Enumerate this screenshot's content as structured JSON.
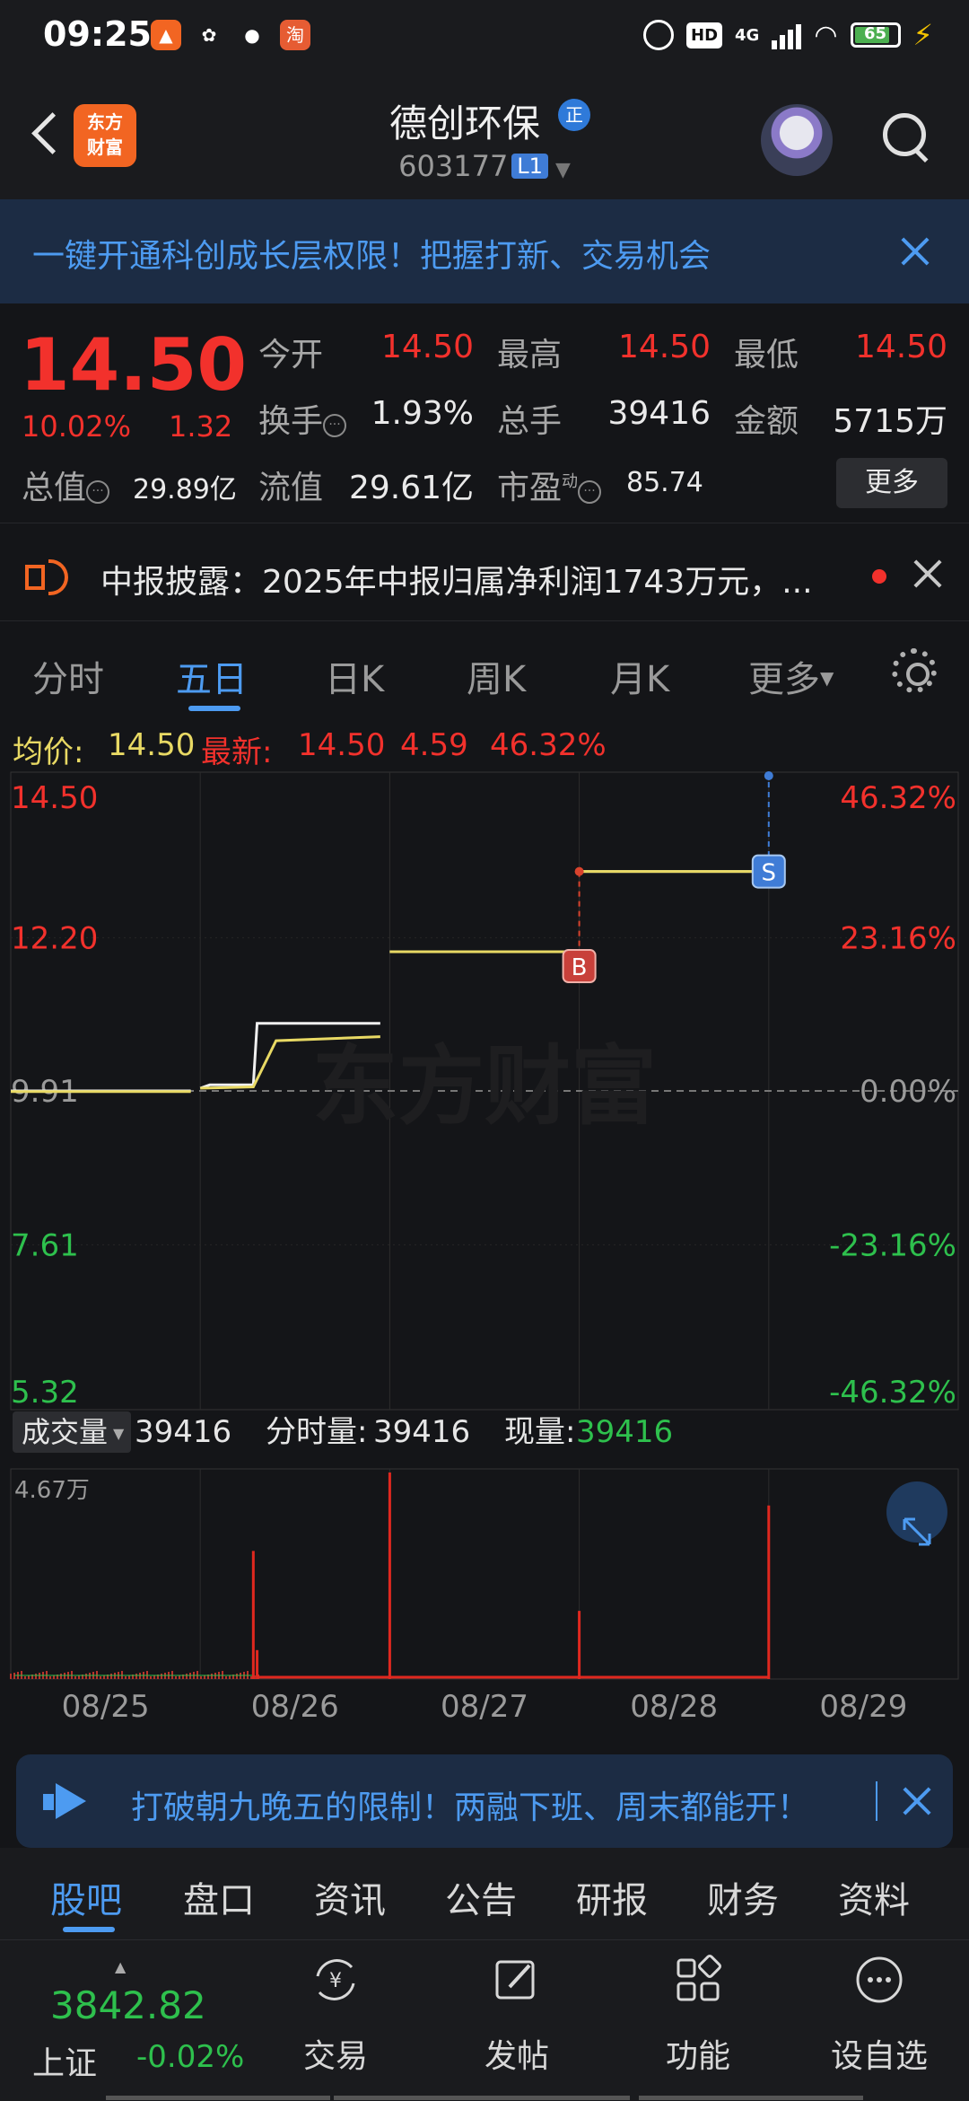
{
  "status": {
    "time": "09:25",
    "net": "4G",
    "battery": "65"
  },
  "header": {
    "logo_line1": "东方",
    "logo_line2": "财富",
    "stock_name": "德创环保",
    "verify": "正",
    "code": "603177",
    "level": "L1"
  },
  "promo": {
    "text": "一键开通科创成长层权限！把握打新、交易机会"
  },
  "quote": {
    "price": "14.50",
    "pct": "10.02%",
    "change": "1.32",
    "open_label": "今开",
    "open": "14.50",
    "high_label": "最高",
    "high": "14.50",
    "low_label": "最低",
    "low": "14.50",
    "turnover_label": "换手",
    "turnover": "1.93%",
    "volume_label": "总手",
    "volume": "39416",
    "amount_label": "金额",
    "amount": "5715万",
    "mktcap_label": "总值",
    "mktcap": "29.89亿",
    "float_label": "流值",
    "float": "29.61亿",
    "pe_label": "市盈",
    "pe_sup": "动",
    "pe": "85.74",
    "more": "更多"
  },
  "notice": {
    "text": "中报披露：2025年中报归属净利润1743万元，..."
  },
  "tabs": [
    "分时",
    "五日",
    "日K",
    "周K",
    "月K",
    "更多"
  ],
  "active_tab": 1,
  "legend": {
    "avg_label": "均价:",
    "avg": "14.50",
    "latest_label": "最新:",
    "latest": "14.50",
    "chg": "4.59",
    "pct": "46.32%"
  },
  "chart_data": {
    "type": "line",
    "title": "",
    "y_ticks_left": [
      "14.50",
      "12.20",
      "9.91",
      "7.61",
      "5.32"
    ],
    "y_ticks_right": [
      "46.32%",
      "23.16%",
      "0.00%",
      "-23.16%",
      "-46.32%"
    ],
    "x_ticks": [
      "08/25",
      "08/26",
      "08/27",
      "08/28",
      "08/29"
    ],
    "ylim": [
      5.32,
      14.5
    ],
    "base_price": 9.91,
    "series": [
      {
        "x": [
          0,
          0.95,
          1.0,
          1.05,
          1.28,
          1.3,
          1.95,
          2.0,
          2.95,
          3.0,
          3.95,
          4.0
        ],
        "y": [
          9.91,
          9.91,
          9.95,
          10.0,
          10.0,
          10.92,
          10.92,
          11.99,
          11.99,
          13.19,
          13.19,
          14.5
        ]
      },
      {
        "x": [
          0,
          0.95,
          1.0,
          1.28,
          1.4,
          1.95,
          2.0,
          2.95,
          3.0,
          3.95,
          4.0
        ],
        "y": [
          9.9,
          9.9,
          9.95,
          9.97,
          10.66,
          10.72,
          11.99,
          11.99,
          13.19,
          13.19,
          14.5
        ]
      }
    ],
    "markers": [
      {
        "label": "B"
      },
      {
        "label": "S"
      }
    ],
    "watermark": "东方财富",
    "volume": {
      "label": "成交量",
      "total": "39416",
      "tick_label": "4.67万",
      "fs_label": "分时量:",
      "fs_value": "39416",
      "now_label": "现量:",
      "now_value": "39416",
      "spikes": [
        {
          "x": 1.28,
          "v": 0.62
        },
        {
          "x": 1.3,
          "v": 0.14
        },
        {
          "x": 2.0,
          "v": 1.0
        },
        {
          "x": 3.0,
          "v": 0.33
        },
        {
          "x": 4.0,
          "v": 0.84
        }
      ]
    }
  },
  "promo2": {
    "text": "打破朝九晚五的限制！两融下班、周末都能开！"
  },
  "bottom_tabs": [
    "股吧",
    "盘口",
    "资讯",
    "公告",
    "研报",
    "财务",
    "资料"
  ],
  "bottom_nav": {
    "index_value": "3842.82",
    "index_name": "上证",
    "index_pct": "-0.02%",
    "items": [
      {
        "label": "交易",
        "icon": "yen-cycle-icon"
      },
      {
        "label": "发帖",
        "icon": "edit-icon"
      },
      {
        "label": "功能",
        "icon": "grid-icon"
      },
      {
        "label": "设自选",
        "icon": "dots-circle-icon"
      }
    ]
  },
  "colors": {
    "red": "#f2312c",
    "green": "#2ec04d",
    "blue": "#4d9bf1",
    "avg_yellow": "#e8d964"
  }
}
